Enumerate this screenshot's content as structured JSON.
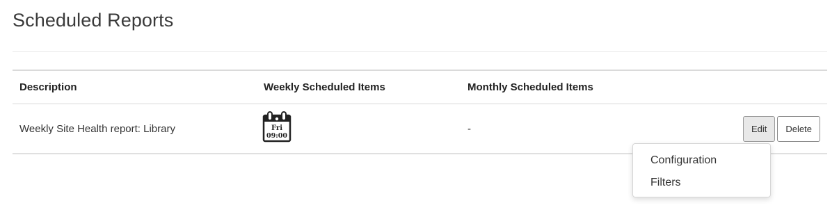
{
  "page": {
    "title": "Scheduled Reports"
  },
  "table": {
    "headers": {
      "description": "Description",
      "weekly": "Weekly Scheduled Items",
      "monthly": "Monthly Scheduled Items"
    },
    "rows": [
      {
        "description": "Weekly Site Health report: Library",
        "weekly": {
          "icon": "calendar-icon",
          "day": "Fri",
          "time": "09:00"
        },
        "monthly": "-",
        "actions": {
          "edit_label": "Edit",
          "delete_label": "Delete"
        }
      }
    ]
  },
  "edit_menu": {
    "open": true,
    "items": [
      {
        "label": "Configuration"
      },
      {
        "label": "Filters"
      }
    ]
  }
}
